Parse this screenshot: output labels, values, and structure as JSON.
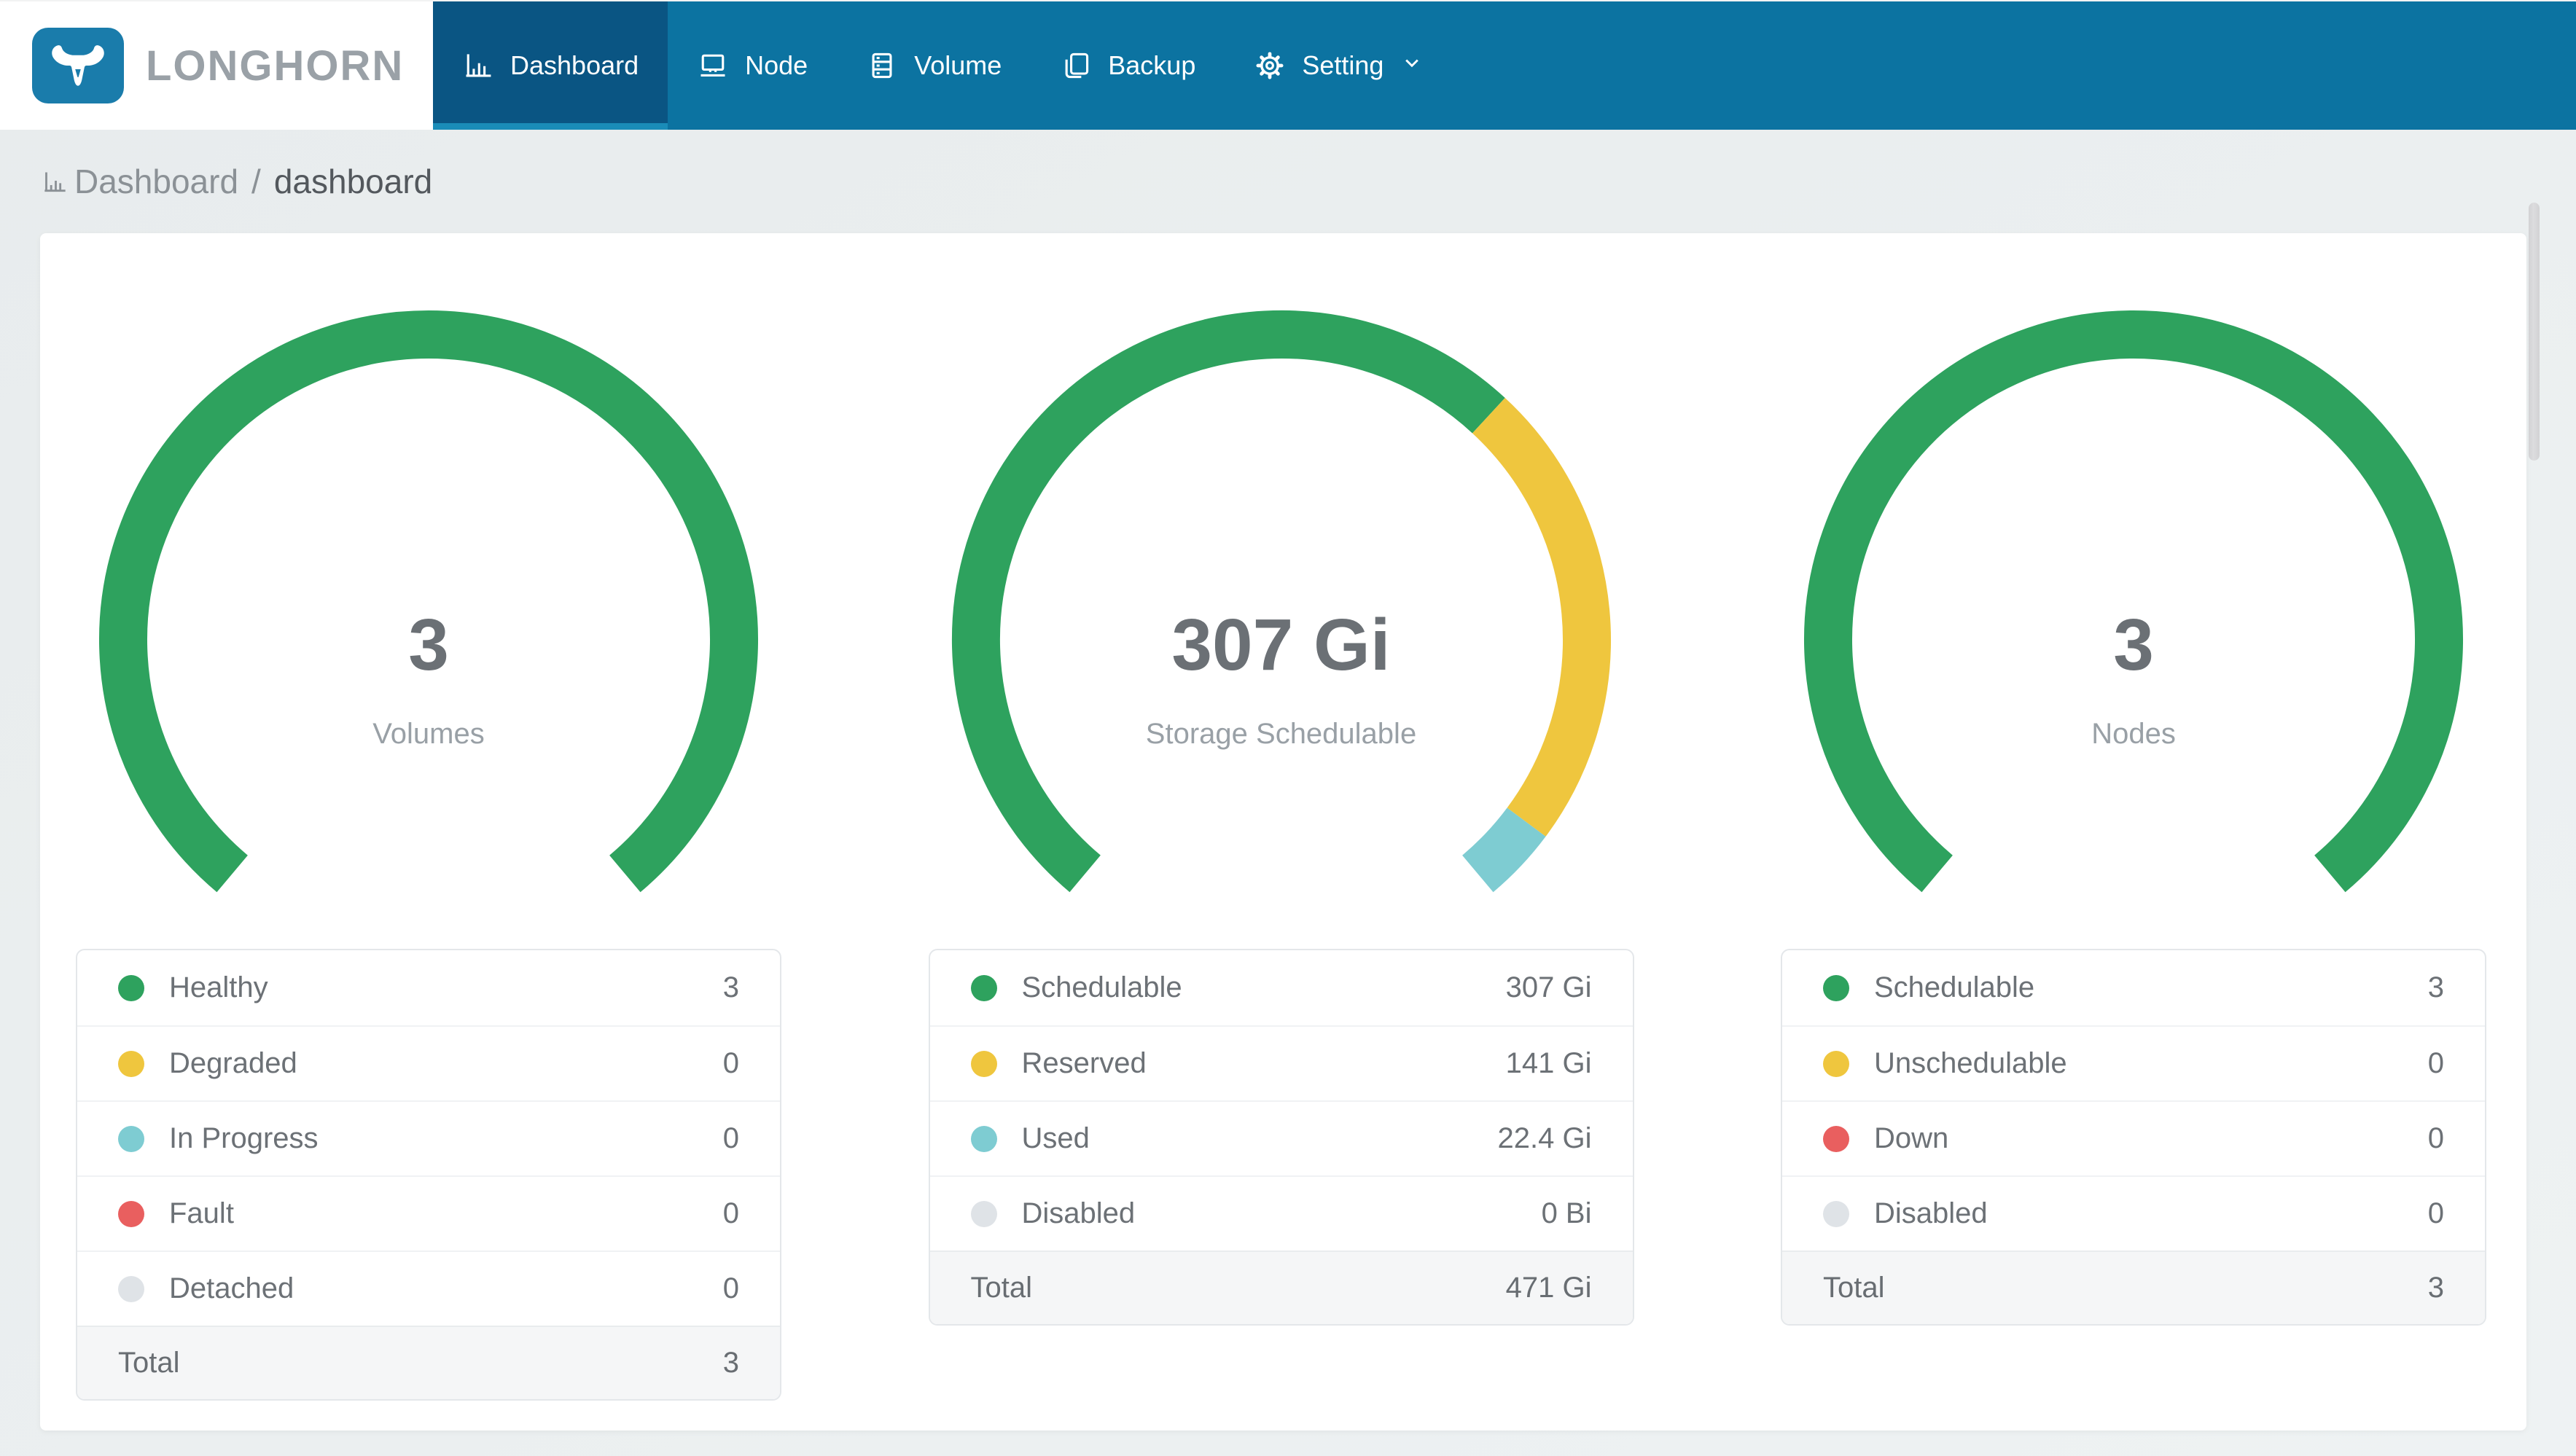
{
  "header": {
    "brand": "LONGHORN",
    "nav": [
      {
        "label": "Dashboard",
        "icon": "bar-chart-icon",
        "active": true
      },
      {
        "label": "Node",
        "icon": "laptop-icon",
        "active": false
      },
      {
        "label": "Volume",
        "icon": "server-icon",
        "active": false
      },
      {
        "label": "Backup",
        "icon": "copy-icon",
        "active": false
      },
      {
        "label": "Setting",
        "icon": "gear-icon",
        "active": false,
        "has_dropdown": true
      }
    ]
  },
  "breadcrumb": {
    "icon": "bar-chart-icon",
    "root": "Dashboard",
    "separator": "/",
    "current": "dashboard"
  },
  "chart_data": [
    {
      "type": "gauge",
      "arc_degrees": 280,
      "center_value": "3",
      "center_label": "Volumes",
      "segments": [
        {
          "label": "Healthy",
          "value": 3,
          "display": "3",
          "color": "#2ea25e"
        },
        {
          "label": "Degraded",
          "value": 0,
          "display": "0",
          "color": "#efc63e"
        },
        {
          "label": "In Progress",
          "value": 0,
          "display": "0",
          "color": "#7eccd2"
        },
        {
          "label": "Fault",
          "value": 0,
          "display": "0",
          "color": "#e95f5f"
        },
        {
          "label": "Detached",
          "value": 0,
          "display": "0",
          "color": "#dfe3e7"
        }
      ],
      "total_label": "Total",
      "total_value": "3"
    },
    {
      "type": "gauge",
      "arc_degrees": 280,
      "center_value": "307 Gi",
      "center_label": "Storage Schedulable",
      "segments": [
        {
          "label": "Schedulable",
          "value": 307,
          "display": "307 Gi",
          "color": "#2ea25e"
        },
        {
          "label": "Reserved",
          "value": 141,
          "display": "141 Gi",
          "color": "#efc63e"
        },
        {
          "label": "Used",
          "value": 22.4,
          "display": "22.4 Gi",
          "color": "#7eccd2"
        },
        {
          "label": "Disabled",
          "value": 0,
          "display": "0 Bi",
          "color": "#dfe3e7"
        }
      ],
      "total_label": "Total",
      "total_value": "471 Gi"
    },
    {
      "type": "gauge",
      "arc_degrees": 280,
      "center_value": "3",
      "center_label": "Nodes",
      "segments": [
        {
          "label": "Schedulable",
          "value": 3,
          "display": "3",
          "color": "#2ea25e"
        },
        {
          "label": "Unschedulable",
          "value": 0,
          "display": "0",
          "color": "#efc63e"
        },
        {
          "label": "Down",
          "value": 0,
          "display": "0",
          "color": "#e95f5f"
        },
        {
          "label": "Disabled",
          "value": 0,
          "display": "0",
          "color": "#dfe3e7"
        }
      ],
      "total_label": "Total",
      "total_value": "3"
    }
  ],
  "colors": {
    "nav_bar": "#0c73a1",
    "active_tab": "#0a5583",
    "active_indicator": "#1a8cb8",
    "logo_blue": "#1a7cab",
    "brand_text": "#9aa1a7",
    "page_background": "#e9edee",
    "healthy_green": "#2ea25e",
    "warning_yellow": "#efc63e",
    "progress_teal": "#7eccd2",
    "fault_red": "#e95f5f",
    "disabled_gray": "#dfe3e7"
  }
}
